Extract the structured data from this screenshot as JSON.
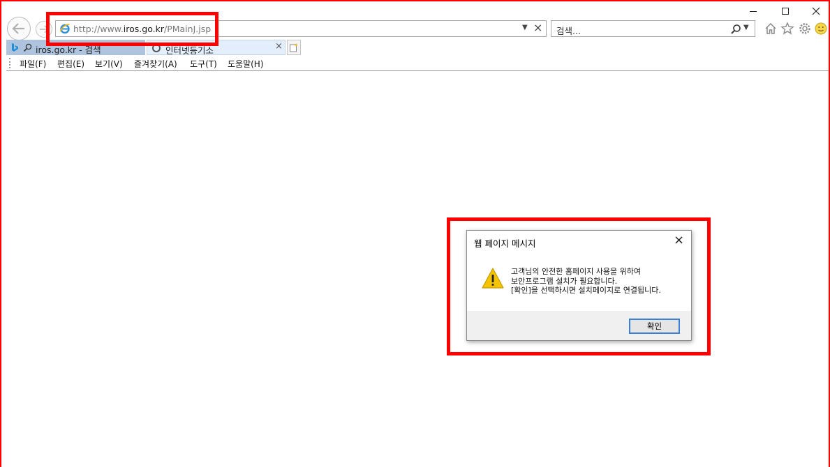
{
  "browser": {
    "address": {
      "prefix": "http://www.",
      "host": "iros.go.kr",
      "path": "/PMainJ.jsp"
    },
    "search_placeholder": "검색...",
    "tabs": [
      {
        "label": "iros.go.kr - 검색"
      },
      {
        "label": "인터넷등기소"
      }
    ],
    "menu": [
      {
        "label": "파일(F)"
      },
      {
        "label": "편집(E)"
      },
      {
        "label": "보기(V)"
      },
      {
        "label": "즐겨찾기(A)"
      },
      {
        "label": "도구(T)"
      },
      {
        "label": "도움말(H)"
      }
    ]
  },
  "dialog": {
    "title": "웹 페이지 메시지",
    "message_lines": [
      "고객님의 안전한 홈페이지 사용을 위하여",
      "보안프로그램 설치가 필요합니다.",
      "[확인]을 선택하시면 설치페이지로 연결됩니다."
    ],
    "ok_label": "확인"
  },
  "colors": {
    "highlight": "#ff0000",
    "tab_active": "#e2eefb",
    "tab_inactive": "#aec4de",
    "warning": "#f5c400",
    "button_focus": "#3c7fd8"
  }
}
